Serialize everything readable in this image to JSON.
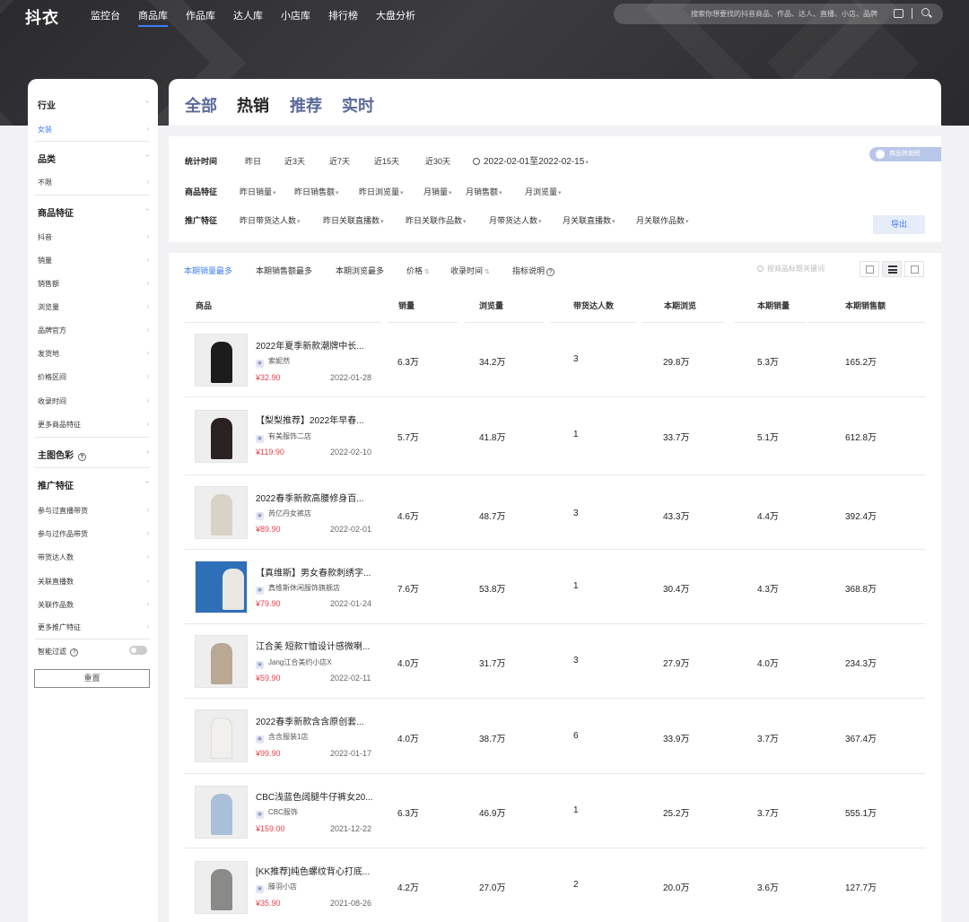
{
  "app": {
    "logo": "抖衣"
  },
  "nav": [
    "监控台",
    "商品库",
    "作品库",
    "达人库",
    "小店库",
    "排行榜",
    "大盘分析"
  ],
  "nav_active": "商品库",
  "search": {
    "placeholder": "搜索你想要找的抖音商品、作品、达人、直播、小店、品牌"
  },
  "sidebar": {
    "sections": [
      {
        "title": "行业",
        "items": [
          "女装"
        ]
      },
      {
        "title": "品类",
        "items": [
          "不限"
        ]
      },
      {
        "title": "商品特征",
        "items": [
          "抖音",
          "销量",
          "销售额",
          "浏览量",
          "品牌官方",
          "发货地",
          "价格区间",
          "收录时间",
          "更多商品特征"
        ]
      },
      {
        "title": "主图色彩",
        "items": []
      },
      {
        "title": "推广特征",
        "items": [
          "参与过直播带货",
          "参与过作品带货",
          "带货达人数",
          "关联直播数",
          "关联作品数",
          "更多推广特征"
        ]
      }
    ],
    "smart_filter": "智能过滤",
    "reset": "重置"
  },
  "tabs": [
    "全部",
    "热销",
    "推荐",
    "实时"
  ],
  "tab_active": "热销",
  "filters": {
    "time_label": "统计时间",
    "time_opts": [
      "昨日",
      "近3天",
      "近7天",
      "近15天",
      "近30天"
    ],
    "date_range": "2022-02-01至2022-02-15",
    "product_label": "商品特征",
    "product_opts": [
      "昨日销量",
      "昨日销售额",
      "昨日浏览量",
      "月销量",
      "月销售额",
      "月浏览量"
    ],
    "promo_label": "推广特征",
    "promo_opts": [
      "昨日带货达人数",
      "昨日关联直播数",
      "昨日关联作品数",
      "月带货达人数",
      "月关联直播数",
      "月关联作品数"
    ],
    "hot_badge": "商品热销榜",
    "export": "导出"
  },
  "sort": {
    "opts": [
      "本期销量最多",
      "本期销售额最多",
      "本期浏览最多",
      "价格",
      "收录时间",
      "指标说明"
    ],
    "active": "本期销量最多",
    "search_placeholder": "按商品标题关键词"
  },
  "table": {
    "columns": [
      "商品",
      "销量",
      "浏览量",
      "带货达人数",
      "本期浏览",
      "本期销量",
      "本期销售额"
    ],
    "rows": [
      {
        "title": "2022年夏季新款潮牌中长...",
        "shop": "索妮然",
        "price": "¥32.90",
        "date": "2022-01-28",
        "sales": "6.3万",
        "views": "34.2万",
        "influencers": "3",
        "period_views": "29.8万",
        "period_sales": "5.3万",
        "period_revenue": "165.2万"
      },
      {
        "title": "【梨梨推荐】2022年早春...",
        "shop": "有美服饰二店",
        "price": "¥119.90",
        "date": "2022-02-10",
        "sales": "5.7万",
        "views": "41.8万",
        "influencers": "1",
        "period_views": "33.7万",
        "period_sales": "5.1万",
        "period_revenue": "612.8万"
      },
      {
        "title": "2022春季新款高腰修身百...",
        "shop": "芮亿丹女裤店",
        "price": "¥89.90",
        "date": "2022-02-01",
        "sales": "4.6万",
        "views": "48.7万",
        "influencers": "3",
        "period_views": "43.3万",
        "period_sales": "4.4万",
        "period_revenue": "392.4万"
      },
      {
        "title": "【真维斯】男女春款刺绣字...",
        "shop": "真维斯休闲服饰旗舰店",
        "price": "¥79.90",
        "date": "2022-01-24",
        "sales": "7.6万",
        "views": "53.8万",
        "influencers": "1",
        "period_views": "30.4万",
        "period_sales": "4.3万",
        "period_revenue": "368.8万"
      },
      {
        "title": "江合美 短款T恤设计感微喇...",
        "shop": "Jang江合美约小店X",
        "price": "¥59.90",
        "date": "2022-02-11",
        "sales": "4.0万",
        "views": "31.7万",
        "influencers": "3",
        "period_views": "27.9万",
        "period_sales": "4.0万",
        "period_revenue": "234.3万"
      },
      {
        "title": "2022春季新款含含原创套...",
        "shop": "含含服装1店",
        "price": "¥99.90",
        "date": "2022-01-17",
        "sales": "4.0万",
        "views": "38.7万",
        "influencers": "6",
        "period_views": "33.9万",
        "period_sales": "3.7万",
        "period_revenue": "367.4万"
      },
      {
        "title": "CBC浅蓝色阔腿牛仔裤女20...",
        "shop": "CBC服饰",
        "price": "¥159.00",
        "date": "2021-12-22",
        "sales": "6.3万",
        "views": "46.9万",
        "influencers": "1",
        "period_views": "25.2万",
        "period_sales": "3.7万",
        "period_revenue": "555.1万"
      },
      {
        "title": "[KK推荐]纯色螺纹背心打底...",
        "shop": "滕羽小店",
        "price": "¥35.90",
        "date": "2021-08-26",
        "sales": "4.2万",
        "views": "27.0万",
        "influencers": "2",
        "period_views": "20.0万",
        "period_sales": "3.6万",
        "period_revenue": "127.7万"
      }
    ]
  },
  "colors": {
    "accent": "#3f7cf6",
    "price": "#e8424c",
    "header_bg": "#2f2f33",
    "tab_inactive": "#5a6a9a"
  }
}
